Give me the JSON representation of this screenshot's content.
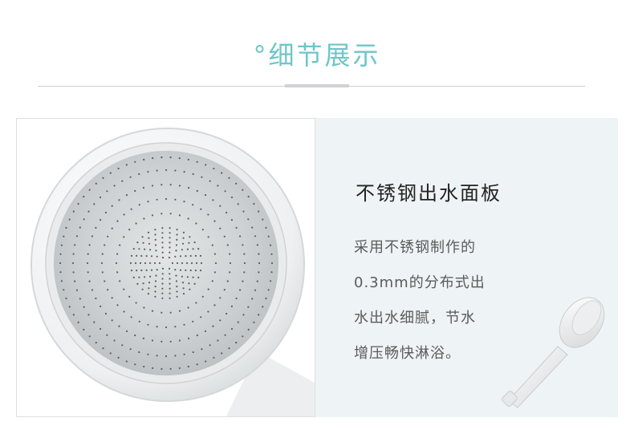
{
  "header": {
    "title": "°细节展示"
  },
  "feature": {
    "title": "不锈钢出水面板",
    "description_lines": [
      "采用不锈钢制作的",
      "0.3mm的分布式出",
      "水出水细腻，节水",
      "增压畅快淋浴。"
    ]
  },
  "colors": {
    "title_accent": "#6ec6c9",
    "panel_background": "#eef3f6",
    "faceplate": "#c9cdd0"
  },
  "images": {
    "main_photo": "shower-head-faceplate-closeup",
    "thumbnail": "handheld-shower-head"
  }
}
